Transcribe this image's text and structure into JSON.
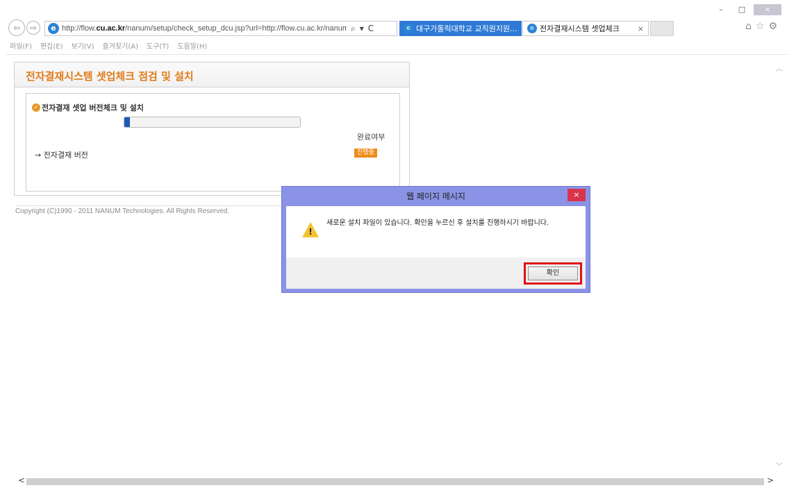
{
  "window": {
    "minimize": "–",
    "maximize": "□",
    "close": "×"
  },
  "nav": {
    "back": "⇦",
    "forward": "⇨",
    "url_prefix": "http://flow.",
    "url_domain": "cu.ac.kr",
    "url_rest": "/nanum/setup/check_setup_dcu.jsp?url=http://flow.cu.ac.kr/nanum/",
    "search_icon": "⌕",
    "dropdown_icon": "▾",
    "refresh_icon": "C"
  },
  "tabs": [
    {
      "label": "대구가톨릭대학교 교직원지원..."
    },
    {
      "label": "전자결재시스템 셋업체크",
      "close": "×"
    }
  ],
  "top_icons": {
    "home": "⌂",
    "favorites": "☆",
    "settings": "⚙"
  },
  "menu": [
    "파일(F)",
    "편집(E)",
    "보기(V)",
    "즐겨찾기(A)",
    "도구(T)",
    "도움말(H)"
  ],
  "panel": {
    "title": "전자결재시스템 셋업체크 점검 및 설치",
    "section_title": "전자결재 셋업 버전체크 및 설치",
    "progress_fraction": 0.03,
    "complete_label": "완료여부",
    "version_label": "→ 전자결재 버전",
    "status_badge": "진행중",
    "status_color": "#f08c1a"
  },
  "copyright": "Copyright (C)1990 - 2011 NANUM Technologies. All Rights Reserved.",
  "dialog": {
    "title": "웹 페이지 메시지",
    "close": "×",
    "message": "새로운 설치 파일이 있습니다. 확인을 누르신 후 설치를 진행하시기 바랍니다.",
    "ok_label": "확인",
    "highlight_color": "#e01010"
  },
  "scroll": {
    "left": "<",
    "right": ">",
    "up": "︿",
    "down": "﹀"
  }
}
